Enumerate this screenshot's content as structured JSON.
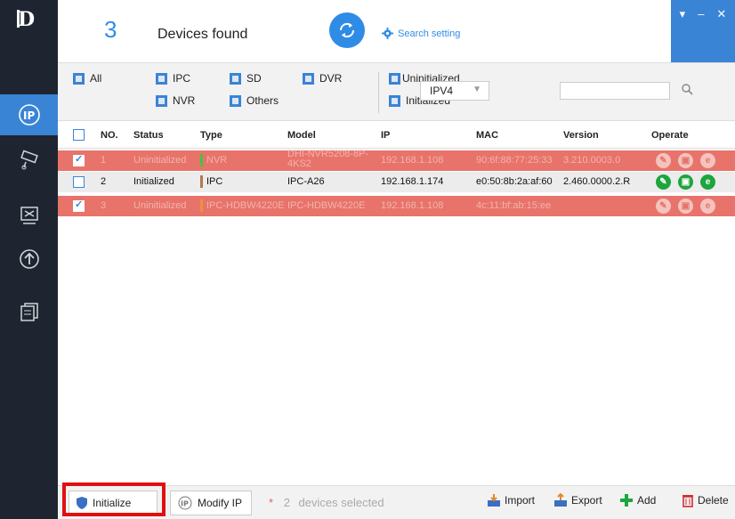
{
  "app": {
    "logo_text": "D"
  },
  "header": {
    "device_count": "3",
    "devices_found_label": "Devices found",
    "search_setting_label": "Search setting"
  },
  "window_controls": [
    "▾",
    "–",
    "✕"
  ],
  "filters": {
    "all": "All",
    "ipc": "IPC",
    "sd": "SD",
    "dvr": "DVR",
    "nvr": "NVR",
    "others": "Others",
    "uninitialized": "Uninitialized",
    "initialized": "Initialized",
    "ip_version": "IPV4",
    "search_value": ""
  },
  "table": {
    "columns": [
      "NO.",
      "Status",
      "Type",
      "Model",
      "IP",
      "MAC",
      "Version",
      "Operate"
    ],
    "rows": [
      {
        "no": "1",
        "status": "Uninitialized",
        "type": "NVR",
        "type_color": "#3cc83c",
        "model": "DHI-NVR5208-8P-4KS2",
        "ip": "192.168.1.108",
        "mac": "90:6f:88:77:25:33",
        "version": "3.210.0003.0",
        "selected": true
      },
      {
        "no": "2",
        "status": "Initialized",
        "type": "IPC",
        "type_color": "#b07a50",
        "model": "IPC-A26",
        "ip": "192.168.1.174",
        "mac": "e0:50:8b:2a:af:60",
        "version": "2.460.0000.2.R",
        "selected": false
      },
      {
        "no": "3",
        "status": "Uninitialized",
        "type": "IPC-HDBW4220E",
        "type_color": "#e8943c",
        "model": "IPC-HDBW4220E",
        "ip": "192.168.1.108",
        "mac": "4c:11:bf:ab:15:ee",
        "version": "",
        "selected": true
      }
    ]
  },
  "bottom": {
    "initialize_label": "Initialize",
    "modify_ip_label": "Modify IP",
    "selected_count": "2",
    "selected_suffix": "devices selected",
    "import_label": "Import",
    "export_label": "Export",
    "add_label": "Add",
    "delete_label": "Delete"
  },
  "colors": {
    "accent": "#3a84d6",
    "selected_row": "#e8736a",
    "sidebar": "#1f2530",
    "ok_green": "#1ea53e",
    "highlight": "#e01010"
  }
}
